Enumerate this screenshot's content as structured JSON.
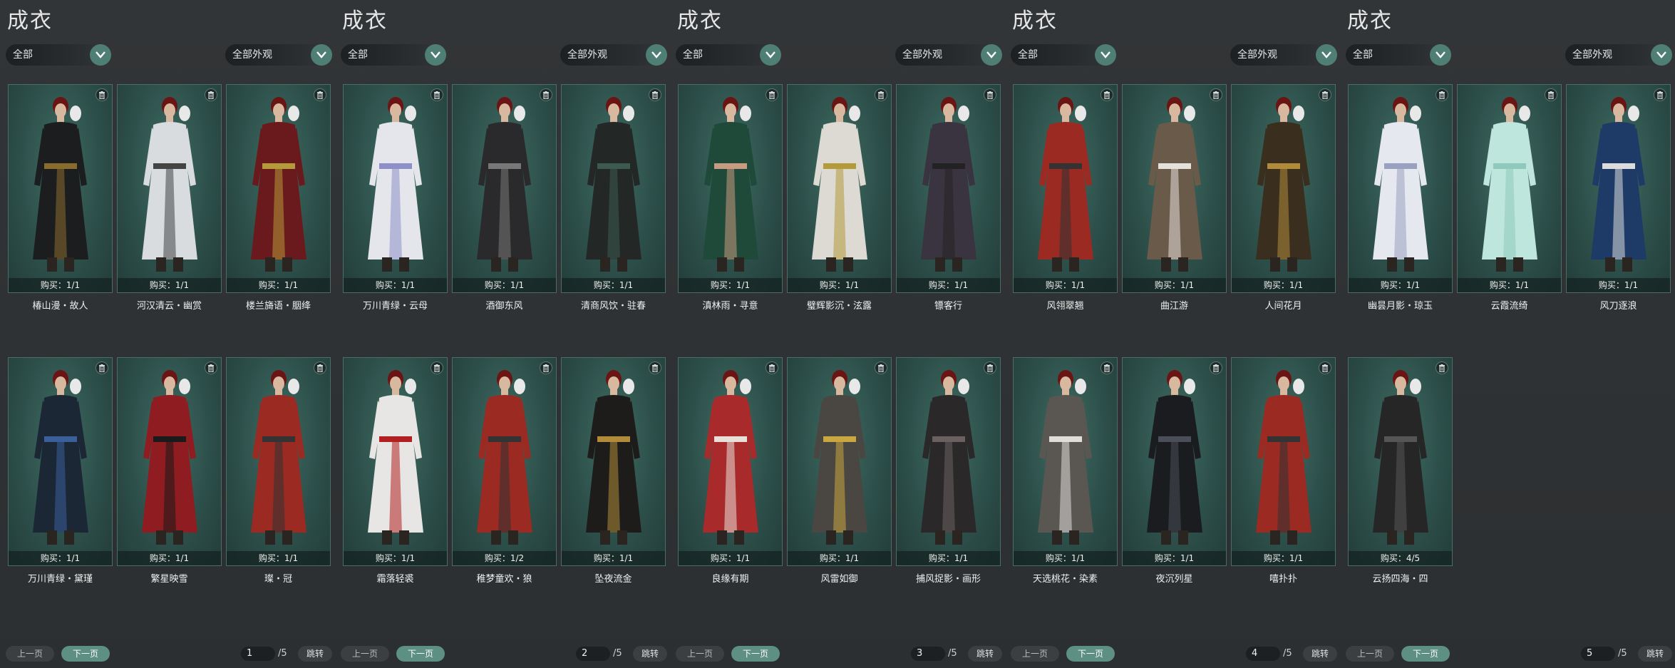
{
  "panels": [
    {
      "title": "成衣",
      "filter_left": "全部",
      "filter_right": "全部外观",
      "page": "1",
      "total": "/5",
      "prev_label": "上一页",
      "next_label": "下一页",
      "jump_label": "跳转",
      "items": [
        {
          "name": "椿山漫・故人",
          "buy": "购买：1/1",
          "tone": "#1b1d1f",
          "accent": "#8a6b2e"
        },
        {
          "name": "河汉清云・幽赏",
          "buy": "购买：1/1",
          "tone": "#d9dcdf",
          "accent": "#444"
        },
        {
          "name": "楼兰旖语・胭绛",
          "buy": "购买：1/1",
          "tone": "#6a1a1c",
          "accent": "#b59a3a"
        },
        {
          "name": "万川青绿・黛瑾",
          "buy": "购买：1/1",
          "tone": "#1c2736",
          "accent": "#3a5f9a"
        },
        {
          "name": "繁星映雪",
          "buy": "购买：1/1",
          "tone": "#8e1c20",
          "accent": "#1a1a1a"
        },
        {
          "name": "璨・冠",
          "buy": "购买：1/1",
          "tone": "#9a2a22",
          "accent": "#333"
        }
      ]
    },
    {
      "title": "成衣",
      "filter_left": "全部",
      "filter_right": "全部外观",
      "page": "2",
      "total": "/5",
      "prev_label": "上一页",
      "next_label": "下一页",
      "jump_label": "跳转",
      "items": [
        {
          "name": "万川青绿・云母",
          "buy": "购买：1/1",
          "tone": "#e4e6ec",
          "accent": "#8c8fc8"
        },
        {
          "name": "酒御东风",
          "buy": "购买：1/1",
          "tone": "#2a2a2c",
          "accent": "#777"
        },
        {
          "name": "清商风饮・驻春",
          "buy": "购买：1/1",
          "tone": "#232826",
          "accent": "#3c5a50"
        },
        {
          "name": "霜落轻裘",
          "buy": "购买：1/1",
          "tone": "#e8e6e4",
          "accent": "#b02020"
        },
        {
          "name": "稚梦童欢・狼",
          "buy": "购买：1/2",
          "tone": "#9a2a22",
          "accent": "#333"
        },
        {
          "name": "坠夜流金",
          "buy": "购买：1/1",
          "tone": "#1e1c1a",
          "accent": "#b08c3a"
        }
      ]
    },
    {
      "title": "成衣",
      "filter_left": "全部",
      "filter_right": "全部外观",
      "page": "3",
      "total": "/5",
      "prev_label": "上一页",
      "next_label": "下一页",
      "jump_label": "跳转",
      "items": [
        {
          "name": "滇林雨・寻意",
          "buy": "购买：1/1",
          "tone": "#1f4a3a",
          "accent": "#c89a80"
        },
        {
          "name": "璧辉影沉・泫露",
          "buy": "购买：1/1",
          "tone": "#dcdad2",
          "accent": "#b59a3a"
        },
        {
          "name": "镖客行",
          "buy": "购买：1/1",
          "tone": "#3a3340",
          "accent": "#222"
        },
        {
          "name": "良缘有期",
          "buy": "购买：1/1",
          "tone": "#a82a2a",
          "accent": "#e8e0d8"
        },
        {
          "name": "风雷如御",
          "buy": "购买：1/1",
          "tone": "#4a4742",
          "accent": "#c9a640"
        },
        {
          "name": "捕风捉影・画形",
          "buy": "购买：1/1",
          "tone": "#2a2828",
          "accent": "#6a6060"
        }
      ]
    },
    {
      "title": "成衣",
      "filter_left": "全部",
      "filter_right": "全部外观",
      "page": "4",
      "total": "/5",
      "prev_label": "上一页",
      "next_label": "下一页",
      "jump_label": "跳转",
      "items": [
        {
          "name": "风翎翠翘",
          "buy": "购买：1/1",
          "tone": "#9a2a22",
          "accent": "#333"
        },
        {
          "name": "曲江游",
          "buy": "购买：1/1",
          "tone": "#6a5a4a",
          "accent": "#e4e0da"
        },
        {
          "name": "人间花月",
          "buy": "购买：1/1",
          "tone": "#3a2e1e",
          "accent": "#b08c3a"
        },
        {
          "name": "天选桃花・染素",
          "buy": "购买：1/1",
          "tone": "#5a5652",
          "accent": "#e0ddd8"
        },
        {
          "name": "夜沉列星",
          "buy": "购买：1/1",
          "tone": "#1a1c20",
          "accent": "#4a4e58"
        },
        {
          "name": "嘻扑扑",
          "buy": "购买：1/1",
          "tone": "#9a2a22",
          "accent": "#333"
        }
      ]
    },
    {
      "title": "成衣",
      "filter_left": "全部",
      "filter_right": "全部外观",
      "page": "5",
      "total": "/5",
      "prev_label": "上一页",
      "next_label": "下一页",
      "jump_label": "跳转",
      "items": [
        {
          "name": "幽昙月影・琼玉",
          "buy": "购买：1/1",
          "tone": "#e6e8f0",
          "accent": "#9aa0c0"
        },
        {
          "name": "云霞流绮",
          "buy": "购买：1/1",
          "tone": "#bfe6dc",
          "accent": "#8fc8bc"
        },
        {
          "name": "风刀逐浪",
          "buy": "购买：1/1",
          "tone": "#1e3a66",
          "accent": "#dcdcdc"
        },
        {
          "name": "云扬四海・四",
          "buy": "购买：4/5",
          "tone": "#262626",
          "accent": "#555"
        }
      ]
    }
  ]
}
